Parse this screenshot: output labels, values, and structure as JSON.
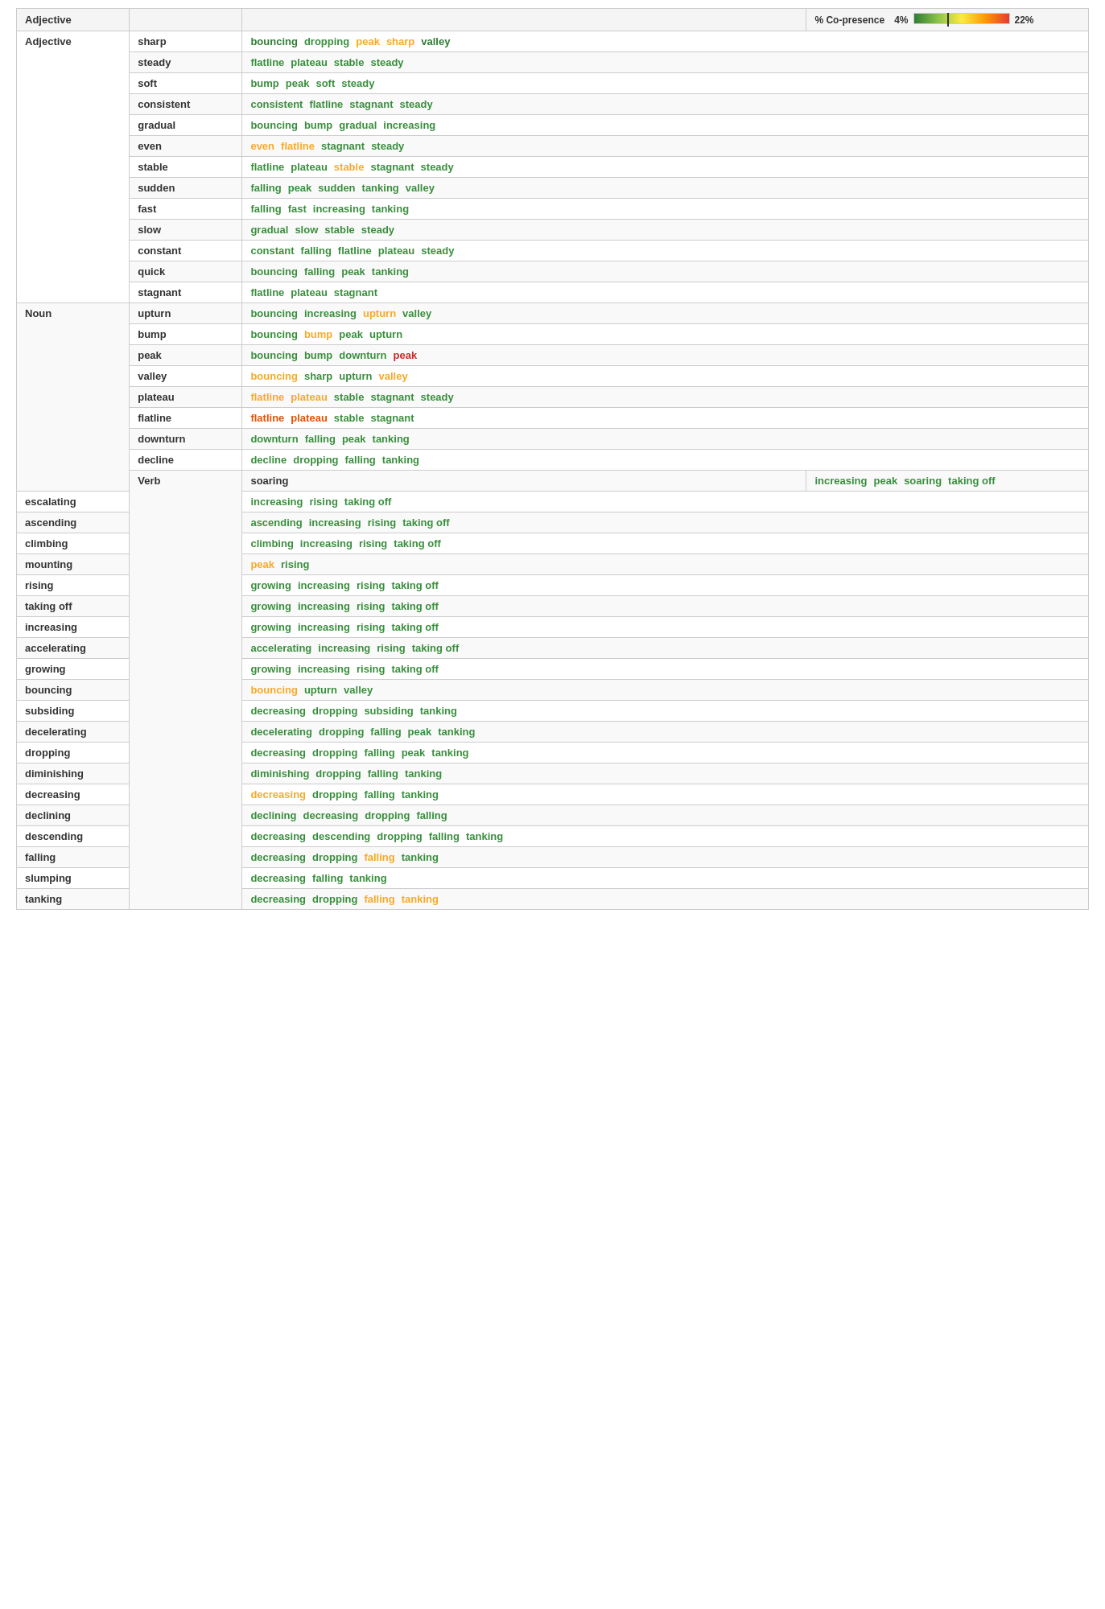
{
  "table": {
    "headers": {
      "category": "Adjective",
      "word": "",
      "tags": "",
      "legend_label": "% Co-presence",
      "legend_min": "4%",
      "legend_max": "22%"
    },
    "rows": [
      {
        "category": "Adjective",
        "rowspan": 13,
        "word": "sharp",
        "tags": [
          {
            "text": "bouncing",
            "color": "c-green-dark"
          },
          {
            "text": "dropping",
            "color": "c-green"
          },
          {
            "text": "peak",
            "color": "c-yellow"
          },
          {
            "text": "sharp",
            "color": "c-yellow"
          },
          {
            "text": "valley",
            "color": "c-green-dark"
          }
        ]
      },
      {
        "category": "",
        "word": "steady",
        "tags": [
          {
            "text": "flatline",
            "color": "c-green"
          },
          {
            "text": "plateau",
            "color": "c-green"
          },
          {
            "text": "stable",
            "color": "c-green"
          },
          {
            "text": "steady",
            "color": "c-green"
          }
        ]
      },
      {
        "category": "",
        "word": "soft",
        "tags": [
          {
            "text": "bump",
            "color": "c-green"
          },
          {
            "text": "peak",
            "color": "c-green"
          },
          {
            "text": "soft",
            "color": "c-green"
          },
          {
            "text": "steady",
            "color": "c-green"
          }
        ]
      },
      {
        "category": "",
        "word": "consistent",
        "tags": [
          {
            "text": "consistent",
            "color": "c-green"
          },
          {
            "text": "flatline",
            "color": "c-green"
          },
          {
            "text": "stagnant",
            "color": "c-green"
          },
          {
            "text": "steady",
            "color": "c-green"
          }
        ]
      },
      {
        "category": "",
        "word": "gradual",
        "tags": [
          {
            "text": "bouncing",
            "color": "c-green"
          },
          {
            "text": "bump",
            "color": "c-green"
          },
          {
            "text": "gradual",
            "color": "c-green"
          },
          {
            "text": "increasing",
            "color": "c-green"
          }
        ]
      },
      {
        "category": "",
        "word": "even",
        "tags": [
          {
            "text": "even",
            "color": "c-yellow"
          },
          {
            "text": "flatline",
            "color": "c-yellow"
          },
          {
            "text": "stagnant",
            "color": "c-green"
          },
          {
            "text": "steady",
            "color": "c-green"
          }
        ]
      },
      {
        "category": "",
        "word": "stable",
        "tags": [
          {
            "text": "flatline",
            "color": "c-green"
          },
          {
            "text": "plateau",
            "color": "c-green"
          },
          {
            "text": "stable",
            "color": "c-yellow"
          },
          {
            "text": "stagnant",
            "color": "c-green"
          },
          {
            "text": "steady",
            "color": "c-green"
          }
        ]
      },
      {
        "category": "",
        "word": "sudden",
        "tags": [
          {
            "text": "falling",
            "color": "c-green"
          },
          {
            "text": "peak",
            "color": "c-green"
          },
          {
            "text": "sudden",
            "color": "c-green"
          },
          {
            "text": "tanking",
            "color": "c-green"
          },
          {
            "text": "valley",
            "color": "c-green"
          }
        ]
      },
      {
        "category": "",
        "word": "fast",
        "tags": [
          {
            "text": "falling",
            "color": "c-green"
          },
          {
            "text": "fast",
            "color": "c-green"
          },
          {
            "text": "increasing",
            "color": "c-green"
          },
          {
            "text": "tanking",
            "color": "c-green"
          }
        ]
      },
      {
        "category": "",
        "word": "slow",
        "tags": [
          {
            "text": "gradual",
            "color": "c-green"
          },
          {
            "text": "slow",
            "color": "c-green"
          },
          {
            "text": "stable",
            "color": "c-green"
          },
          {
            "text": "steady",
            "color": "c-green"
          }
        ]
      },
      {
        "category": "",
        "word": "constant",
        "tags": [
          {
            "text": "constant",
            "color": "c-green"
          },
          {
            "text": "falling",
            "color": "c-green"
          },
          {
            "text": "flatline",
            "color": "c-green"
          },
          {
            "text": "plateau",
            "color": "c-green"
          },
          {
            "text": "steady",
            "color": "c-green"
          }
        ]
      },
      {
        "category": "",
        "word": "quick",
        "tags": [
          {
            "text": "bouncing",
            "color": "c-green"
          },
          {
            "text": "falling",
            "color": "c-green"
          },
          {
            "text": "peak",
            "color": "c-green"
          },
          {
            "text": "tanking",
            "color": "c-green"
          }
        ]
      },
      {
        "category": "",
        "word": "stagnant",
        "tags": [
          {
            "text": "flatline",
            "color": "c-green"
          },
          {
            "text": "plateau",
            "color": "c-green"
          },
          {
            "text": "stagnant",
            "color": "c-green"
          }
        ]
      },
      {
        "category": "Noun",
        "rowspan": 9,
        "word": "upturn",
        "tags": [
          {
            "text": "bouncing",
            "color": "c-green"
          },
          {
            "text": "increasing",
            "color": "c-green"
          },
          {
            "text": "upturn",
            "color": "c-yellow"
          },
          {
            "text": "valley",
            "color": "c-green"
          }
        ]
      },
      {
        "category": "",
        "word": "bump",
        "tags": [
          {
            "text": "bouncing",
            "color": "c-green"
          },
          {
            "text": "bump",
            "color": "c-yellow"
          },
          {
            "text": "peak",
            "color": "c-green"
          },
          {
            "text": "upturn",
            "color": "c-green"
          }
        ]
      },
      {
        "category": "",
        "word": "peak",
        "tags": [
          {
            "text": "bouncing",
            "color": "c-green"
          },
          {
            "text": "bump",
            "color": "c-green"
          },
          {
            "text": "downturn",
            "color": "c-green"
          },
          {
            "text": "peak",
            "color": "c-red"
          }
        ]
      },
      {
        "category": "",
        "word": "valley",
        "tags": [
          {
            "text": "bouncing",
            "color": "c-yellow"
          },
          {
            "text": "sharp",
            "color": "c-green"
          },
          {
            "text": "upturn",
            "color": "c-green"
          },
          {
            "text": "valley",
            "color": "c-yellow"
          }
        ]
      },
      {
        "category": "",
        "word": "plateau",
        "tags": [
          {
            "text": "flatline",
            "color": "c-yellow"
          },
          {
            "text": "plateau",
            "color": "c-yellow"
          },
          {
            "text": "stable",
            "color": "c-green"
          },
          {
            "text": "stagnant",
            "color": "c-green"
          },
          {
            "text": "steady",
            "color": "c-green"
          }
        ]
      },
      {
        "category": "",
        "word": "flatline",
        "tags": [
          {
            "text": "flatline",
            "color": "c-orange"
          },
          {
            "text": "plateau",
            "color": "c-orange"
          },
          {
            "text": "stable",
            "color": "c-green"
          },
          {
            "text": "stagnant",
            "color": "c-green"
          }
        ]
      },
      {
        "category": "",
        "word": "downturn",
        "tags": [
          {
            "text": "downturn",
            "color": "c-green"
          },
          {
            "text": "falling",
            "color": "c-green"
          },
          {
            "text": "peak",
            "color": "c-green"
          },
          {
            "text": "tanking",
            "color": "c-green"
          }
        ]
      },
      {
        "category": "",
        "word": "decline",
        "tags": [
          {
            "text": "decline",
            "color": "c-green"
          },
          {
            "text": "dropping",
            "color": "c-green"
          },
          {
            "text": "falling",
            "color": "c-green"
          },
          {
            "text": "tanking",
            "color": "c-green"
          }
        ]
      },
      {
        "category": "Verb",
        "rowspan": 21,
        "word": "soaring",
        "tags": [
          {
            "text": "increasing",
            "color": "c-green"
          },
          {
            "text": "peak",
            "color": "c-green"
          },
          {
            "text": "soaring",
            "color": "c-green"
          },
          {
            "text": "taking off",
            "color": "c-green"
          }
        ]
      },
      {
        "category": "",
        "word": "escalating",
        "tags": [
          {
            "text": "increasing",
            "color": "c-green"
          },
          {
            "text": "rising",
            "color": "c-green"
          },
          {
            "text": "taking off",
            "color": "c-green"
          }
        ]
      },
      {
        "category": "",
        "word": "ascending",
        "tags": [
          {
            "text": "ascending",
            "color": "c-green"
          },
          {
            "text": "increasing",
            "color": "c-green"
          },
          {
            "text": "rising",
            "color": "c-green"
          },
          {
            "text": "taking off",
            "color": "c-green"
          }
        ]
      },
      {
        "category": "",
        "word": "climbing",
        "tags": [
          {
            "text": "climbing",
            "color": "c-green"
          },
          {
            "text": "increasing",
            "color": "c-green"
          },
          {
            "text": "rising",
            "color": "c-green"
          },
          {
            "text": "taking off",
            "color": "c-green"
          }
        ]
      },
      {
        "category": "",
        "word": "mounting",
        "tags": [
          {
            "text": "peak",
            "color": "c-yellow"
          },
          {
            "text": "rising",
            "color": "c-green"
          }
        ]
      },
      {
        "category": "",
        "word": "rising",
        "tags": [
          {
            "text": "growing",
            "color": "c-green"
          },
          {
            "text": "increasing",
            "color": "c-green"
          },
          {
            "text": "rising",
            "color": "c-green"
          },
          {
            "text": "taking off",
            "color": "c-green"
          }
        ]
      },
      {
        "category": "",
        "word": "taking off",
        "tags": [
          {
            "text": "growing",
            "color": "c-green"
          },
          {
            "text": "increasing",
            "color": "c-green"
          },
          {
            "text": "rising",
            "color": "c-green"
          },
          {
            "text": "taking off",
            "color": "c-green"
          }
        ]
      },
      {
        "category": "",
        "word": "increasing",
        "tags": [
          {
            "text": "growing",
            "color": "c-green"
          },
          {
            "text": "increasing",
            "color": "c-green"
          },
          {
            "text": "rising",
            "color": "c-green"
          },
          {
            "text": "taking off",
            "color": "c-green"
          }
        ]
      },
      {
        "category": "",
        "word": "accelerating",
        "tags": [
          {
            "text": "accelerating",
            "color": "c-green"
          },
          {
            "text": "increasing",
            "color": "c-green"
          },
          {
            "text": "rising",
            "color": "c-green"
          },
          {
            "text": "taking off",
            "color": "c-green"
          }
        ]
      },
      {
        "category": "",
        "word": "growing",
        "tags": [
          {
            "text": "growing",
            "color": "c-green"
          },
          {
            "text": "increasing",
            "color": "c-green"
          },
          {
            "text": "rising",
            "color": "c-green"
          },
          {
            "text": "taking off",
            "color": "c-green"
          }
        ]
      },
      {
        "category": "",
        "word": "bouncing",
        "tags": [
          {
            "text": "bouncing",
            "color": "c-yellow"
          },
          {
            "text": "upturn",
            "color": "c-green"
          },
          {
            "text": "valley",
            "color": "c-green"
          }
        ]
      },
      {
        "category": "",
        "word": "subsiding",
        "tags": [
          {
            "text": "decreasing",
            "color": "c-green"
          },
          {
            "text": "dropping",
            "color": "c-green"
          },
          {
            "text": "subsiding",
            "color": "c-green"
          },
          {
            "text": "tanking",
            "color": "c-green"
          }
        ]
      },
      {
        "category": "",
        "word": "decelerating",
        "tags": [
          {
            "text": "decelerating",
            "color": "c-green"
          },
          {
            "text": "dropping",
            "color": "c-green"
          },
          {
            "text": "falling",
            "color": "c-green"
          },
          {
            "text": "peak",
            "color": "c-green"
          },
          {
            "text": "tanking",
            "color": "c-green"
          }
        ]
      },
      {
        "category": "",
        "word": "dropping",
        "tags": [
          {
            "text": "decreasing",
            "color": "c-green"
          },
          {
            "text": "dropping",
            "color": "c-green"
          },
          {
            "text": "falling",
            "color": "c-green"
          },
          {
            "text": "peak",
            "color": "c-green"
          },
          {
            "text": "tanking",
            "color": "c-green"
          }
        ]
      },
      {
        "category": "",
        "word": "diminishing",
        "tags": [
          {
            "text": "diminishing",
            "color": "c-green"
          },
          {
            "text": "dropping",
            "color": "c-green"
          },
          {
            "text": "falling",
            "color": "c-green"
          },
          {
            "text": "tanking",
            "color": "c-green"
          }
        ]
      },
      {
        "category": "",
        "word": "decreasing",
        "tags": [
          {
            "text": "decreasing",
            "color": "c-yellow"
          },
          {
            "text": "dropping",
            "color": "c-green"
          },
          {
            "text": "falling",
            "color": "c-green"
          },
          {
            "text": "tanking",
            "color": "c-green"
          }
        ]
      },
      {
        "category": "",
        "word": "declining",
        "tags": [
          {
            "text": "declining",
            "color": "c-green"
          },
          {
            "text": "decreasing",
            "color": "c-green"
          },
          {
            "text": "dropping",
            "color": "c-green"
          },
          {
            "text": "falling",
            "color": "c-green"
          }
        ]
      },
      {
        "category": "",
        "word": "descending",
        "tags": [
          {
            "text": "decreasing",
            "color": "c-green"
          },
          {
            "text": "descending",
            "color": "c-green"
          },
          {
            "text": "dropping",
            "color": "c-green"
          },
          {
            "text": "falling",
            "color": "c-green"
          },
          {
            "text": "tanking",
            "color": "c-green"
          }
        ]
      },
      {
        "category": "",
        "word": "falling",
        "tags": [
          {
            "text": "decreasing",
            "color": "c-green"
          },
          {
            "text": "dropping",
            "color": "c-green"
          },
          {
            "text": "falling",
            "color": "c-yellow"
          },
          {
            "text": "tanking",
            "color": "c-green"
          }
        ]
      },
      {
        "category": "",
        "word": "slumping",
        "tags": [
          {
            "text": "decreasing",
            "color": "c-green"
          },
          {
            "text": "falling",
            "color": "c-green"
          },
          {
            "text": "tanking",
            "color": "c-green"
          }
        ]
      },
      {
        "category": "",
        "word": "tanking",
        "tags": [
          {
            "text": "decreasing",
            "color": "c-green"
          },
          {
            "text": "dropping",
            "color": "c-green"
          },
          {
            "text": "falling",
            "color": "c-yellow"
          },
          {
            "text": "tanking",
            "color": "c-yellow"
          }
        ]
      }
    ]
  }
}
